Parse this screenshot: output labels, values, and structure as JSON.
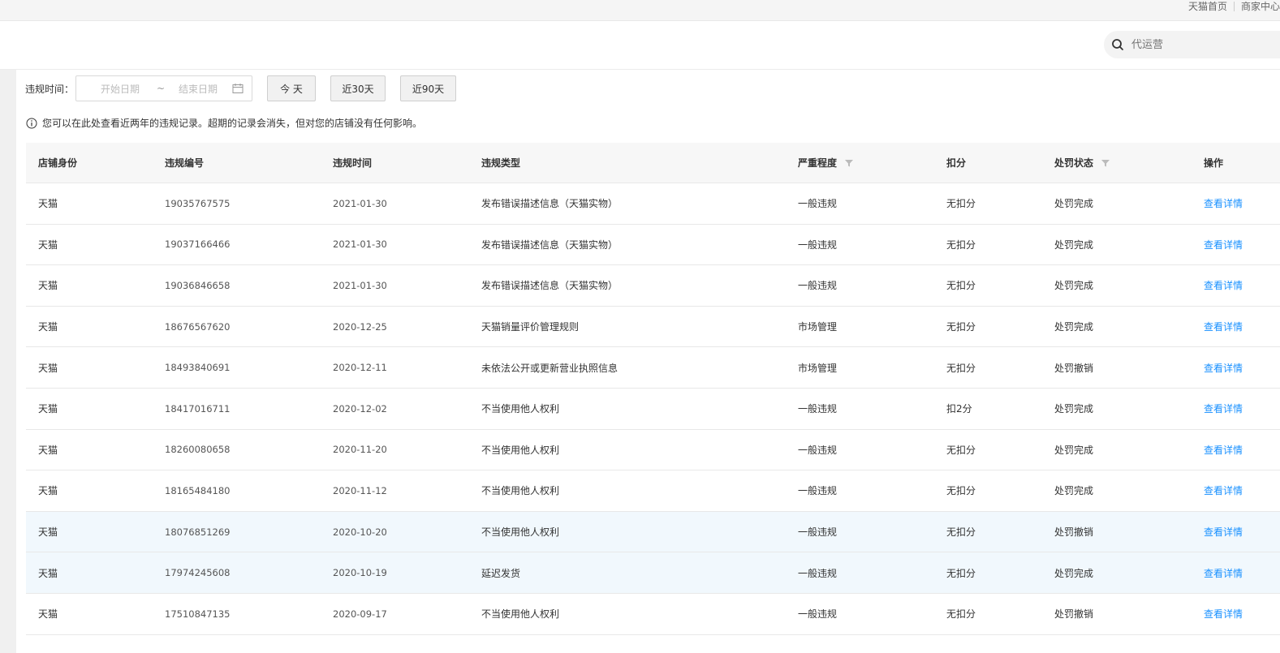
{
  "topnav": {
    "items": [
      "天猫首页",
      "商家中心"
    ]
  },
  "search": {
    "placeholder": "代运营"
  },
  "filter": {
    "label": "违规时间：",
    "start_placeholder": "开始日期",
    "separator": "~",
    "end_placeholder": "结束日期",
    "btn_today": "今 天",
    "btn_30": "近30天",
    "btn_90": "近90天"
  },
  "notice": {
    "text": "您可以在此处查看近两年的违规记录。超期的记录会消失，但对您的店铺没有任何影响。"
  },
  "table": {
    "headers": [
      "店铺身份",
      "违规编号",
      "违规时间",
      "违规类型",
      "严重程度",
      "扣分",
      "处罚状态",
      "操作"
    ],
    "rows": [
      [
        "天猫",
        "19035767575",
        "2021-01-30",
        "发布错误描述信息（天猫实物）",
        "一般违规",
        "无扣分",
        "处罚完成",
        "查看详情"
      ],
      [
        "天猫",
        "19037166466",
        "2021-01-30",
        "发布错误描述信息（天猫实物）",
        "一般违规",
        "无扣分",
        "处罚完成",
        "查看详情"
      ],
      [
        "天猫",
        "19036846658",
        "2021-01-30",
        "发布错误描述信息（天猫实物）",
        "一般违规",
        "无扣分",
        "处罚完成",
        "查看详情"
      ],
      [
        "天猫",
        "18676567620",
        "2020-12-25",
        "天猫销量评价管理规则",
        "市场管理",
        "无扣分",
        "处罚完成",
        "查看详情"
      ],
      [
        "天猫",
        "18493840691",
        "2020-12-11",
        "未依法公开或更新营业执照信息",
        "市场管理",
        "无扣分",
        "处罚撤销",
        "查看详情"
      ],
      [
        "天猫",
        "18417016711",
        "2020-12-02",
        "不当使用他人权利",
        "一般违规",
        "扣2分",
        "处罚完成",
        "查看详情"
      ],
      [
        "天猫",
        "18260080658",
        "2020-11-20",
        "不当使用他人权利",
        "一般违规",
        "无扣分",
        "处罚完成",
        "查看详情"
      ],
      [
        "天猫",
        "18165484180",
        "2020-11-12",
        "不当使用他人权利",
        "一般违规",
        "无扣分",
        "处罚完成",
        "查看详情"
      ],
      [
        "天猫",
        "18076851269",
        "2020-10-20",
        "不当使用他人权利",
        "一般违规",
        "无扣分",
        "处罚撤销",
        "查看详情"
      ],
      [
        "天猫",
        "17974245608",
        "2020-10-19",
        "延迟发货",
        "一般违规",
        "无扣分",
        "处罚完成",
        "查看详情"
      ],
      [
        "天猫",
        "17510847135",
        "2020-09-17",
        "不当使用他人权利",
        "一般违规",
        "无扣分",
        "处罚撤销",
        "查看详情"
      ]
    ]
  },
  "colors": {
    "link": "#1890ff",
    "highlight_row": "#f1f8fd"
  }
}
